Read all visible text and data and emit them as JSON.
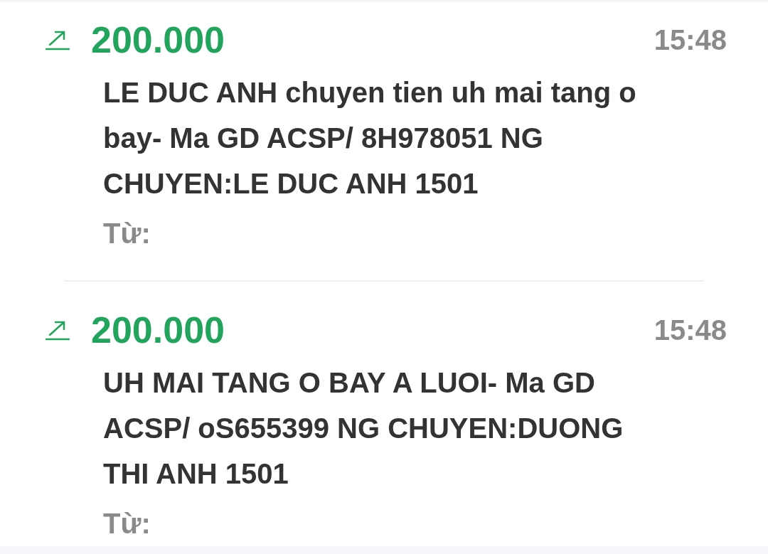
{
  "transactions": [
    {
      "kind": "incoming",
      "amount": "200.000",
      "time": "15:48",
      "description": "LE DUC ANH chuyen tien uh mai tang o bay- Ma GD ACSP/ 8H978051 NG CHUYEN:LE DUC ANH 1501",
      "from_label": "Từ:"
    },
    {
      "kind": "incoming",
      "amount": "200.000",
      "time": "15:48",
      "description": "UH MAI TANG O BAY A LUOI- Ma GD ACSP/ oS655399 NG CHUYEN:DUONG THI ANH 1501",
      "from_label": "Từ:"
    }
  ]
}
